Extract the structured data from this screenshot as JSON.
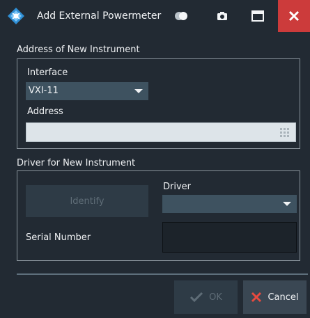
{
  "window": {
    "title": "Add External Powermeter",
    "icons": [
      "app-logo-icon",
      "toggle-icon",
      "camera-icon",
      "maximize-icon",
      "close-icon"
    ],
    "close_color": "#cc3b3b"
  },
  "address_group": {
    "label": "Address of New Instrument",
    "interface_label": "Interface",
    "interface_value": "VXI-11",
    "address_label": "Address",
    "address_value": ""
  },
  "driver_group": {
    "label": "Driver for New Instrument",
    "identify_label": "Identify",
    "driver_label": "Driver",
    "driver_value": "",
    "serial_label": "Serial Number",
    "serial_value": ""
  },
  "footer": {
    "ok_label": "OK",
    "cancel_label": "Cancel"
  }
}
